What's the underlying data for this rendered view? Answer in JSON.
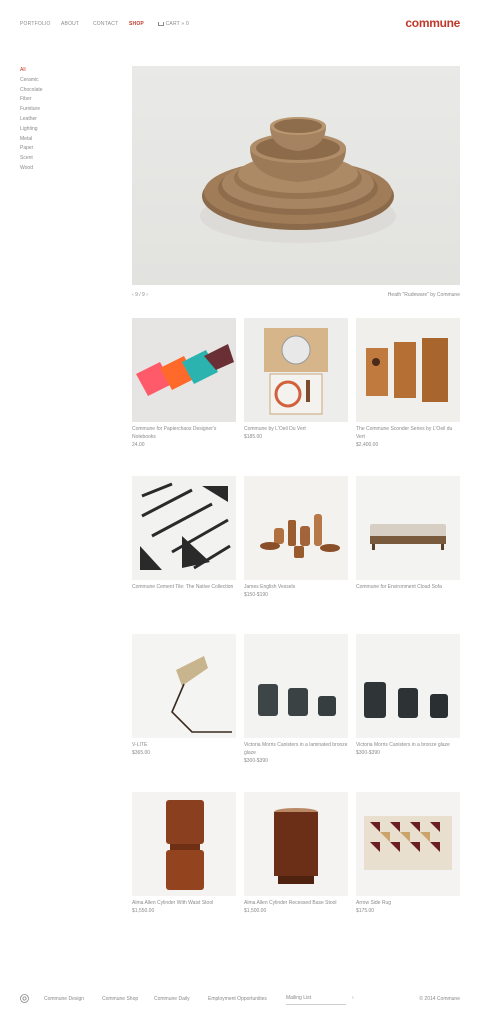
{
  "nav": {
    "items": [
      {
        "label": "PORTFOLIO"
      },
      {
        "label": "ABOUT"
      },
      {
        "label": "CONTACT"
      },
      {
        "label": "SHOP",
        "active": true
      },
      {
        "label": "CART"
      }
    ],
    "cart_count": "0",
    "brand": "commune"
  },
  "sidebar": {
    "items": [
      "All",
      "Ceramic",
      "Chocolate",
      "Fiber",
      "Furniture",
      "Leather",
      "Lighting",
      "Metal",
      "Paper",
      "Scent",
      "Wood"
    ],
    "active_index": 0
  },
  "hero": {
    "pager": "9 / 9",
    "caption": "Heath \"Rudeware\" by Commune"
  },
  "products": [
    {
      "name": "Commune for Papierchaos Designer's Notebooks",
      "price": "24.00"
    },
    {
      "name": "Commune by L'Oeil Du Vert",
      "price": "$185.00"
    },
    {
      "name": "The Commune Sconder Series by L'Oeil du Vert",
      "price": "$2,400.00"
    },
    {
      "name": "Commune Cement Tile: The Native Collection",
      "price": ""
    },
    {
      "name": "James English Vessels",
      "price": "$150-$190"
    },
    {
      "name": "Commune for Environment Cloud Sofa",
      "price": ""
    },
    {
      "name": "V-LITE",
      "price": "$365.00"
    },
    {
      "name": "Victoria Morris Canisters in a laminated bronze glaze",
      "price": "$300-$390"
    },
    {
      "name": "Victoria Morris Canisters in a bronze glaze",
      "price": "$300-$390"
    },
    {
      "name": "Alma Allen Cylinder With Waist Stool",
      "price": "$1,550.00"
    },
    {
      "name": "Alma Allen Cylinder Recessed Base Stool",
      "price": "$1,500.00"
    },
    {
      "name": "Arrow Side Rug",
      "price": "$175.00"
    }
  ],
  "footer": {
    "links": [
      "Commune Design",
      "Commune Shop",
      "Commune Daily",
      "Employment Opportunities"
    ],
    "mailing_list": "Mailing List",
    "copyright": "© 2014 Commune"
  },
  "colors": {
    "accent": "#c0392b",
    "text": "#8a8a8a"
  },
  "icons": [
    "cart-icon",
    "prev-arrow-icon",
    "next-arrow-icon",
    "instagram-icon",
    "submit-arrow-icon"
  ]
}
